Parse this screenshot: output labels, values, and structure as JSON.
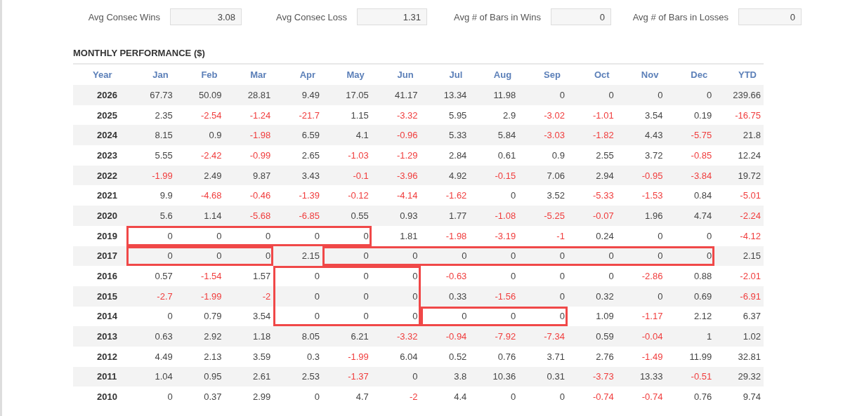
{
  "stats": [
    {
      "label": "Avg Consec Wins",
      "value": "3.08"
    },
    {
      "label": "Avg Consec Loss",
      "value": "1.31"
    },
    {
      "label": "Avg # of Bars in Wins",
      "value": "0"
    },
    {
      "label": "Avg # of Bars in Losses",
      "value": "0"
    }
  ],
  "section_title": "MONTHLY PERFORMANCE ($)",
  "table": {
    "year_header": "Year",
    "columns": [
      "Jan",
      "Feb",
      "Mar",
      "Apr",
      "May",
      "Jun",
      "Jul",
      "Aug",
      "Sep",
      "Oct",
      "Nov",
      "Dec",
      "YTD"
    ],
    "rows": [
      {
        "year": "2026",
        "cells": [
          {
            "value": "67.73",
            "negative": false
          },
          {
            "value": "50.09",
            "negative": false
          },
          {
            "value": "28.81",
            "negative": false
          },
          {
            "value": "9.49",
            "negative": false
          },
          {
            "value": "17.05",
            "negative": false
          },
          {
            "value": "41.17",
            "negative": false
          },
          {
            "value": "13.34",
            "negative": false
          },
          {
            "value": "11.98",
            "negative": false
          },
          {
            "value": "0",
            "negative": false
          },
          {
            "value": "0",
            "negative": false
          },
          {
            "value": "0",
            "negative": false
          },
          {
            "value": "0",
            "negative": false
          },
          {
            "value": "239.66",
            "negative": false
          }
        ]
      },
      {
        "year": "2025",
        "cells": [
          {
            "value": "2.35",
            "negative": false
          },
          {
            "value": "-2.54",
            "negative": true
          },
          {
            "value": "-1.24",
            "negative": true
          },
          {
            "value": "-21.7",
            "negative": true
          },
          {
            "value": "1.15",
            "negative": false
          },
          {
            "value": "-3.32",
            "negative": true
          },
          {
            "value": "5.95",
            "negative": false
          },
          {
            "value": "2.9",
            "negative": false
          },
          {
            "value": "-3.02",
            "negative": true
          },
          {
            "value": "-1.01",
            "negative": true
          },
          {
            "value": "3.54",
            "negative": false
          },
          {
            "value": "0.19",
            "negative": false
          },
          {
            "value": "-16.75",
            "negative": true
          }
        ]
      },
      {
        "year": "2024",
        "cells": [
          {
            "value": "8.15",
            "negative": false
          },
          {
            "value": "0.9",
            "negative": false
          },
          {
            "value": "-1.98",
            "negative": true
          },
          {
            "value": "6.59",
            "negative": false
          },
          {
            "value": "4.1",
            "negative": false
          },
          {
            "value": "-0.96",
            "negative": true
          },
          {
            "value": "5.33",
            "negative": false
          },
          {
            "value": "5.84",
            "negative": false
          },
          {
            "value": "-3.03",
            "negative": true
          },
          {
            "value": "-1.82",
            "negative": true
          },
          {
            "value": "4.43",
            "negative": false
          },
          {
            "value": "-5.75",
            "negative": true
          },
          {
            "value": "21.8",
            "negative": false
          }
        ]
      },
      {
        "year": "2023",
        "cells": [
          {
            "value": "5.55",
            "negative": false
          },
          {
            "value": "-2.42",
            "negative": true
          },
          {
            "value": "-0.99",
            "negative": true
          },
          {
            "value": "2.65",
            "negative": false
          },
          {
            "value": "-1.03",
            "negative": true
          },
          {
            "value": "-1.29",
            "negative": true
          },
          {
            "value": "2.84",
            "negative": false
          },
          {
            "value": "0.61",
            "negative": false
          },
          {
            "value": "0.9",
            "negative": false
          },
          {
            "value": "2.55",
            "negative": false
          },
          {
            "value": "3.72",
            "negative": false
          },
          {
            "value": "-0.85",
            "negative": true
          },
          {
            "value": "12.24",
            "negative": false
          }
        ]
      },
      {
        "year": "2022",
        "cells": [
          {
            "value": "-1.99",
            "negative": true
          },
          {
            "value": "2.49",
            "negative": false
          },
          {
            "value": "9.87",
            "negative": false
          },
          {
            "value": "3.43",
            "negative": false
          },
          {
            "value": "-0.1",
            "negative": true
          },
          {
            "value": "-3.96",
            "negative": true
          },
          {
            "value": "4.92",
            "negative": false
          },
          {
            "value": "-0.15",
            "negative": true
          },
          {
            "value": "7.06",
            "negative": false
          },
          {
            "value": "2.94",
            "negative": false
          },
          {
            "value": "-0.95",
            "negative": true
          },
          {
            "value": "-3.84",
            "negative": true
          },
          {
            "value": "19.72",
            "negative": false
          }
        ]
      },
      {
        "year": "2021",
        "cells": [
          {
            "value": "9.9",
            "negative": false
          },
          {
            "value": "-4.68",
            "negative": true
          },
          {
            "value": "-0.46",
            "negative": true
          },
          {
            "value": "-1.39",
            "negative": true
          },
          {
            "value": "-0.12",
            "negative": true
          },
          {
            "value": "-4.14",
            "negative": true
          },
          {
            "value": "-1.62",
            "negative": true
          },
          {
            "value": "0",
            "negative": false
          },
          {
            "value": "3.52",
            "negative": false
          },
          {
            "value": "-5.33",
            "negative": true
          },
          {
            "value": "-1.53",
            "negative": true
          },
          {
            "value": "0.84",
            "negative": false
          },
          {
            "value": "-5.01",
            "negative": true
          }
        ]
      },
      {
        "year": "2020",
        "cells": [
          {
            "value": "5.6",
            "negative": false
          },
          {
            "value": "1.14",
            "negative": false
          },
          {
            "value": "-5.68",
            "negative": true
          },
          {
            "value": "-6.85",
            "negative": true
          },
          {
            "value": "0.55",
            "negative": false
          },
          {
            "value": "0.93",
            "negative": false
          },
          {
            "value": "1.77",
            "negative": false
          },
          {
            "value": "-1.08",
            "negative": true
          },
          {
            "value": "-5.25",
            "negative": true
          },
          {
            "value": "-0.07",
            "negative": true
          },
          {
            "value": "1.96",
            "negative": false
          },
          {
            "value": "4.74",
            "negative": false
          },
          {
            "value": "-2.24",
            "negative": true
          }
        ]
      },
      {
        "year": "2019",
        "cells": [
          {
            "value": "0",
            "negative": false,
            "outlined": true
          },
          {
            "value": "0",
            "negative": false,
            "outlined": true
          },
          {
            "value": "0",
            "negative": false,
            "outlined": true
          },
          {
            "value": "0",
            "negative": false,
            "outlined": true
          },
          {
            "value": "0",
            "negative": false,
            "outlined": true
          },
          {
            "value": "1.81",
            "negative": false
          },
          {
            "value": "-1.98",
            "negative": true
          },
          {
            "value": "-3.19",
            "negative": true
          },
          {
            "value": "-1",
            "negative": true
          },
          {
            "value": "0.24",
            "negative": false
          },
          {
            "value": "0",
            "negative": false
          },
          {
            "value": "0",
            "negative": false
          },
          {
            "value": "-4.12",
            "negative": true
          }
        ]
      },
      {
        "year": "2017",
        "cells": [
          {
            "value": "0",
            "negative": false,
            "outlined": true
          },
          {
            "value": "0",
            "negative": false,
            "outlined": true
          },
          {
            "value": "0",
            "negative": false,
            "outlined": true
          },
          {
            "value": "2.15",
            "negative": false
          },
          {
            "value": "0",
            "negative": false,
            "outlined": true
          },
          {
            "value": "0",
            "negative": false,
            "outlined": true
          },
          {
            "value": "0",
            "negative": false,
            "outlined": true
          },
          {
            "value": "0",
            "negative": false,
            "outlined": true
          },
          {
            "value": "0",
            "negative": false,
            "outlined": true
          },
          {
            "value": "0",
            "negative": false,
            "outlined": true
          },
          {
            "value": "0",
            "negative": false,
            "outlined": true
          },
          {
            "value": "0",
            "negative": false,
            "outlined": true
          },
          {
            "value": "2.15",
            "negative": false
          }
        ]
      },
      {
        "year": "2016",
        "cells": [
          {
            "value": "0.57",
            "negative": false
          },
          {
            "value": "-1.54",
            "negative": true
          },
          {
            "value": "1.57",
            "negative": false
          },
          {
            "value": "0",
            "negative": false,
            "outlined": true,
            "open_bottom": true
          },
          {
            "value": "0",
            "negative": false,
            "outlined": true,
            "open_bottom": true
          },
          {
            "value": "0",
            "negative": false,
            "outlined": true,
            "open_bottom": true
          },
          {
            "value": "-0.63",
            "negative": true
          },
          {
            "value": "0",
            "negative": false
          },
          {
            "value": "0",
            "negative": false
          },
          {
            "value": "0",
            "negative": false
          },
          {
            "value": "-2.86",
            "negative": true
          },
          {
            "value": "0.88",
            "negative": false
          },
          {
            "value": "-2.01",
            "negative": true
          }
        ]
      },
      {
        "year": "2015",
        "cells": [
          {
            "value": "-2.7",
            "negative": true
          },
          {
            "value": "-1.99",
            "negative": true
          },
          {
            "value": "-2",
            "negative": true
          },
          {
            "value": "0",
            "negative": false,
            "outlined": true,
            "open_top": true,
            "open_bottom": true
          },
          {
            "value": "0",
            "negative": false,
            "outlined": true,
            "open_top": true,
            "open_bottom": true
          },
          {
            "value": "0",
            "negative": false,
            "outlined": true,
            "open_top": true,
            "open_bottom": true
          },
          {
            "value": "0.33",
            "negative": false
          },
          {
            "value": "-1.56",
            "negative": true
          },
          {
            "value": "0",
            "negative": false
          },
          {
            "value": "0.32",
            "negative": false
          },
          {
            "value": "0",
            "negative": false
          },
          {
            "value": "0.69",
            "negative": false
          },
          {
            "value": "-6.91",
            "negative": true
          }
        ]
      },
      {
        "year": "2014",
        "cells": [
          {
            "value": "0",
            "negative": false
          },
          {
            "value": "0.79",
            "negative": false
          },
          {
            "value": "3.54",
            "negative": false
          },
          {
            "value": "0",
            "negative": false,
            "outlined": true,
            "open_top": true
          },
          {
            "value": "0",
            "negative": false,
            "outlined": true,
            "open_top": true
          },
          {
            "value": "0",
            "negative": false,
            "outlined": true,
            "open_top": true
          },
          {
            "value": "0",
            "negative": false,
            "outlined": true,
            "box_start": true
          },
          {
            "value": "0",
            "negative": false,
            "outlined": true
          },
          {
            "value": "0",
            "negative": false,
            "outlined": true
          },
          {
            "value": "1.09",
            "negative": false
          },
          {
            "value": "-1.17",
            "negative": true
          },
          {
            "value": "2.12",
            "negative": false
          },
          {
            "value": "6.37",
            "negative": false
          }
        ]
      },
      {
        "year": "2013",
        "cells": [
          {
            "value": "0.63",
            "negative": false
          },
          {
            "value": "2.92",
            "negative": false
          },
          {
            "value": "1.18",
            "negative": false
          },
          {
            "value": "8.05",
            "negative": false
          },
          {
            "value": "6.21",
            "negative": false
          },
          {
            "value": "-3.32",
            "negative": true
          },
          {
            "value": "-0.94",
            "negative": true
          },
          {
            "value": "-7.92",
            "negative": true
          },
          {
            "value": "-7.34",
            "negative": true
          },
          {
            "value": "0.59",
            "negative": false
          },
          {
            "value": "-0.04",
            "negative": true
          },
          {
            "value": "1",
            "negative": false
          },
          {
            "value": "1.02",
            "negative": false
          }
        ]
      },
      {
        "year": "2012",
        "cells": [
          {
            "value": "4.49",
            "negative": false
          },
          {
            "value": "2.13",
            "negative": false
          },
          {
            "value": "3.59",
            "negative": false
          },
          {
            "value": "0.3",
            "negative": false
          },
          {
            "value": "-1.99",
            "negative": true
          },
          {
            "value": "6.04",
            "negative": false
          },
          {
            "value": "0.52",
            "negative": false
          },
          {
            "value": "0.76",
            "negative": false
          },
          {
            "value": "3.71",
            "negative": false
          },
          {
            "value": "2.76",
            "negative": false
          },
          {
            "value": "-1.49",
            "negative": true
          },
          {
            "value": "11.99",
            "negative": false
          },
          {
            "value": "32.81",
            "negative": false
          }
        ]
      },
      {
        "year": "2011",
        "cells": [
          {
            "value": "1.04",
            "negative": false
          },
          {
            "value": "0.95",
            "negative": false
          },
          {
            "value": "2.61",
            "negative": false
          },
          {
            "value": "2.53",
            "negative": false
          },
          {
            "value": "-1.37",
            "negative": true
          },
          {
            "value": "0",
            "negative": false
          },
          {
            "value": "3.8",
            "negative": false
          },
          {
            "value": "10.36",
            "negative": false
          },
          {
            "value": "0.31",
            "negative": false
          },
          {
            "value": "-3.73",
            "negative": true
          },
          {
            "value": "13.33",
            "negative": false
          },
          {
            "value": "-0.51",
            "negative": true
          },
          {
            "value": "29.32",
            "negative": false
          }
        ]
      },
      {
        "year": "2010",
        "cells": [
          {
            "value": "0",
            "negative": false
          },
          {
            "value": "0.37",
            "negative": false
          },
          {
            "value": "2.99",
            "negative": false
          },
          {
            "value": "0",
            "negative": false
          },
          {
            "value": "4.7",
            "negative": false
          },
          {
            "value": "-2",
            "negative": true
          },
          {
            "value": "4.4",
            "negative": false
          },
          {
            "value": "0",
            "negative": false
          },
          {
            "value": "0",
            "negative": false
          },
          {
            "value": "-0.74",
            "negative": true
          },
          {
            "value": "-0.74",
            "negative": true
          },
          {
            "value": "0.76",
            "negative": false
          },
          {
            "value": "9.74",
            "negative": false
          }
        ]
      }
    ]
  }
}
